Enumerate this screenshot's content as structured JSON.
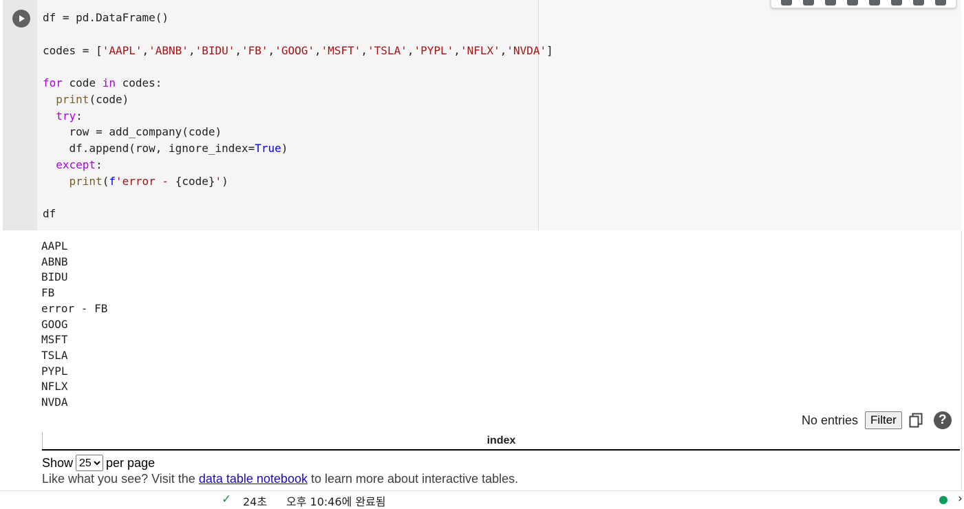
{
  "toolbar": {
    "icons": [
      "arrow-up-icon",
      "arrow-down-icon",
      "link-icon",
      "comment-icon",
      "gear-icon",
      "mirror-cell-icon",
      "delete-icon",
      "more-icon"
    ]
  },
  "code_lines": [
    "df = pd.DataFrame()",
    "",
    "codes = ['AAPL','ABNB','BIDU','FB','GOOG','MSFT','TSLA','PYPL','NFLX','NVDA']",
    "",
    "for code in codes:",
    "  print(code)",
    "  try:",
    "    row = add_company(code)",
    "    df.append(row, ignore_index=True)",
    "  except:",
    "    print(f'error - {code}')",
    "",
    "df"
  ],
  "output_lines": [
    "AAPL",
    "ABNB",
    "BIDU",
    "FB",
    "error - FB",
    "GOOG",
    "MSFT",
    "TSLA",
    "PYPL",
    "NFLX",
    "NVDA"
  ],
  "datatable": {
    "no_entries": "No entries",
    "filter_label": "Filter",
    "help_label": "?",
    "column_header": "index",
    "show_label": "Show",
    "per_page_value": "25",
    "per_page_label": "per page",
    "note_prefix": "Like what you see? Visit the",
    "note_link": "data table notebook",
    "note_suffix": "to learn more about interactive tables."
  },
  "status": {
    "check": "✓",
    "elapsed": "24초",
    "completed": "오후 10:46에 완료됨",
    "chevron": "›"
  },
  "colors": {
    "keyword": "#af00db",
    "function": "#795e26",
    "string": "#a31515",
    "builtin": "#0000ff",
    "success": "#0f9d58"
  }
}
